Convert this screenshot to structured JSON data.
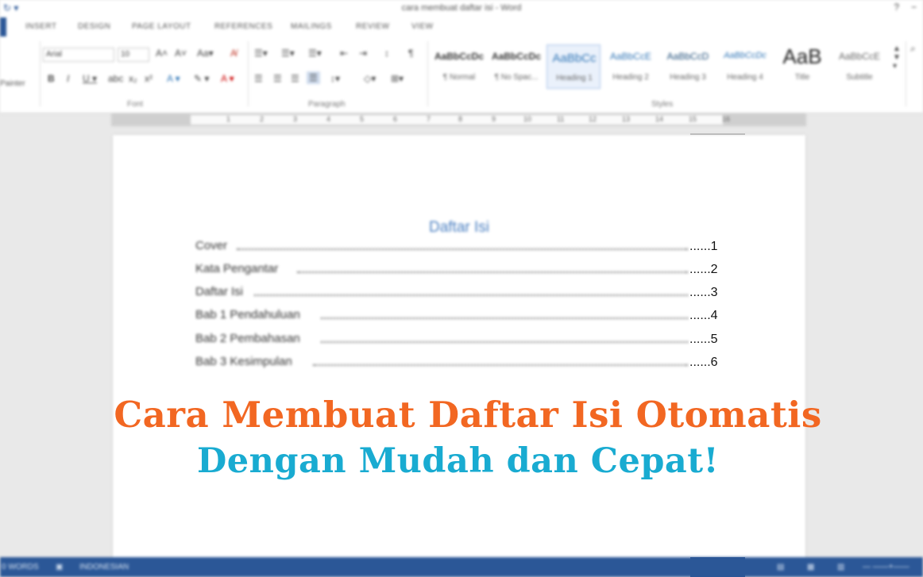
{
  "window": {
    "title": "cara membuat daftar isi - Word",
    "help": "?",
    "minimize": "−"
  },
  "ribbon": {
    "tabs": [
      "INSERT",
      "DESIGN",
      "PAGE LAYOUT",
      "REFERENCES",
      "MAILINGS",
      "REVIEW",
      "VIEW"
    ],
    "clipboard_label": "Painter",
    "font_name": "Arial",
    "font_size": "10",
    "groups": {
      "font": "Font",
      "paragraph": "Paragraph",
      "styles": "Styles"
    },
    "styles": [
      {
        "sample": "AaBbCcDc",
        "label": "¶ Normal"
      },
      {
        "sample": "AaBbCcDc",
        "label": "¶ No Spac..."
      },
      {
        "sample": "AaBbCc",
        "label": "Heading 1"
      },
      {
        "sample": "AaBbCcE",
        "label": "Heading 2"
      },
      {
        "sample": "AaBbCcD",
        "label": "Heading 3"
      },
      {
        "sample": "AaBbCcDc",
        "label": "Heading 4"
      },
      {
        "sample": "AaB",
        "label": "Title"
      },
      {
        "sample": "AaBbCcE",
        "label": "Subtitle"
      }
    ]
  },
  "ruler": {
    "numbers": [
      "1",
      "2",
      "3",
      "4",
      "5",
      "6",
      "7",
      "8",
      "9",
      "10",
      "11",
      "12",
      "13",
      "14",
      "15",
      "16"
    ]
  },
  "document": {
    "toc_heading": "Daftar Isi",
    "toc": [
      {
        "title": "Cover",
        "page": "......1"
      },
      {
        "title": "Kata Pengantar",
        "page": "......2"
      },
      {
        "title": "Daftar Isi",
        "page": "......3"
      },
      {
        "title": "Bab 1 Pendahuluan",
        "page": "......4"
      },
      {
        "title": "Bab 2 Pembahasan",
        "page": "......5"
      },
      {
        "title": "Bab 3 Kesimpulan",
        "page": "......6"
      }
    ]
  },
  "headline": {
    "line1": "Cara Membuat Daftar Isi Otomatis",
    "line2": "Dengan Mudah dan Cepat!",
    "color1": "#f26722",
    "color2": "#19abd1"
  },
  "statusbar": {
    "words": "0 WORDS",
    "language": "INDONESIAN"
  }
}
